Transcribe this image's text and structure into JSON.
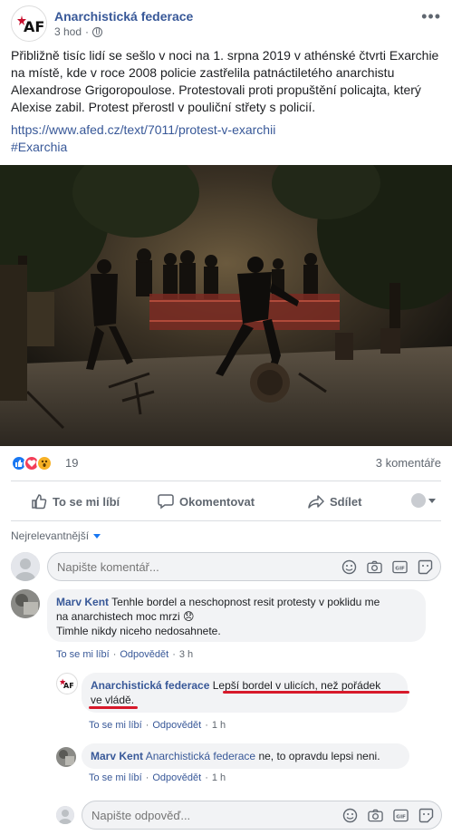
{
  "post": {
    "page_name": "Anarchistická federace",
    "logo_text": "AF",
    "time": "3 hod",
    "time_separator": "·",
    "text": "Přibližně tisíc lidí se sešlo v noci na 1. srpna 2019 v athénské čtvrti Exarchie na místě, kde v roce 2008 policie zastřelila patnáctiletého anarchistu Alexandrose Grigoropoulose. Protestovali proti propuštění policajta, který Alexise zabil. Protest přerostl v pouliční střety s policií.",
    "link": "https://www.afed.cz/text/7011/protest-v-exarchii",
    "hashtag": "#Exarchia"
  },
  "reactions": {
    "types": [
      "like",
      "love",
      "wow"
    ],
    "count": "19",
    "comments": "3 komentáře"
  },
  "actions": {
    "like": "To se mi líbí",
    "comment": "Okomentovat",
    "share": "Sdílet"
  },
  "sort": {
    "label": "Nejrelevantnější"
  },
  "composer": {
    "placeholder": "Napište komentář..."
  },
  "comments": [
    {
      "author": "Marv Kent",
      "line1": "Tenhle bordel a neschopnost resit protesty v poklidu me",
      "line2": "na anarchistech moc mrzi 😞",
      "line3": "Timhle nikdy niceho nedosahnete.",
      "like": "To se mi líbí",
      "reply": "Odpovědět",
      "time": "3 h"
    },
    {
      "author": "Anarchistická federace",
      "line1": "Lepší bordel v ulicích, než pořádek",
      "line2": "ve vládě.",
      "like": "To se mi líbí",
      "reply": "Odpovědět",
      "time": "1 h"
    },
    {
      "author": "Marv Kent",
      "mention": "Anarchistická federace",
      "text": "ne, to opravdu lepsi neni.",
      "like": "To se mi líbí",
      "reply": "Odpovědět",
      "time": "1 h"
    }
  ],
  "reply_composer": {
    "placeholder": "Napište odpověď..."
  },
  "colors": {
    "link": "#385898",
    "accent": "#1877f2",
    "annotation": "#d7192a"
  },
  "icons": [
    "af-logo",
    "globe-icon",
    "more-icon",
    "like-icon",
    "comment-icon",
    "share-icon",
    "emoji-icon",
    "camera-icon",
    "gif-icon",
    "sticker-icon"
  ]
}
